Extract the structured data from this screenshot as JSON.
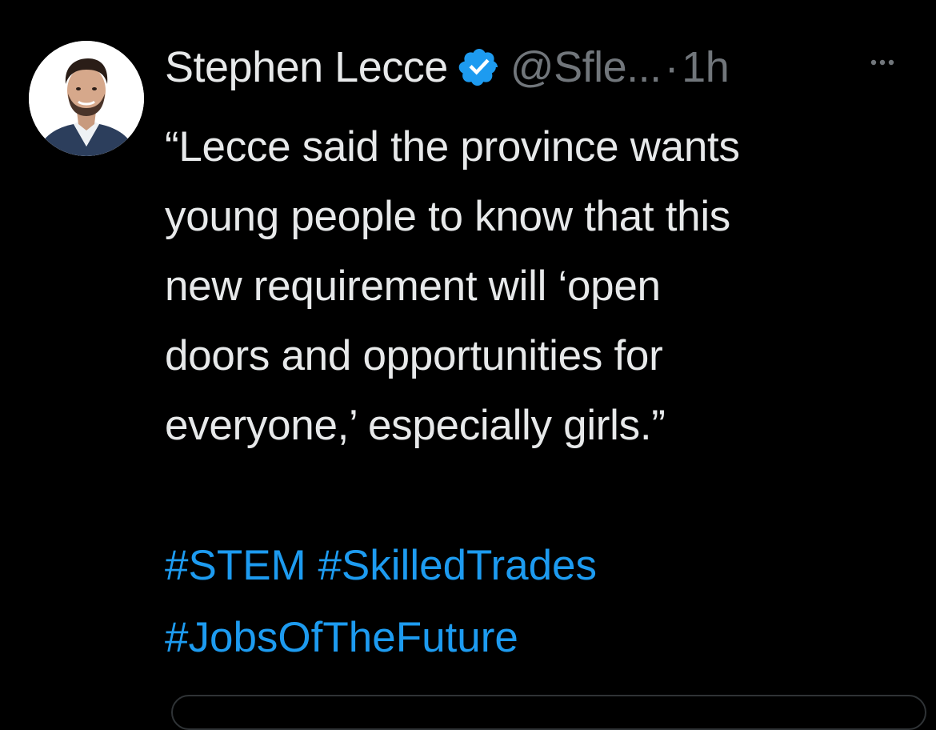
{
  "author": {
    "display_name": "Stephen Lecce",
    "handle": "@Sfle...",
    "separator": "·",
    "time": "1h",
    "verified_icon": "verified-badge-icon",
    "more_icon": "more-options-icon"
  },
  "tweet": {
    "lines": [
      "“Lecce said the province wants",
      "young people to know that this",
      "new requirement will ‘open",
      "doors and opportunities for",
      "everyone,’ especially girls.”"
    ],
    "hashtags": [
      "#STEM",
      "#SkilledTrades",
      "#JobsOfTheFuture"
    ]
  },
  "colors": {
    "background": "#000000",
    "primary_text": "#e7e9ea",
    "secondary_text": "#71767b",
    "link": "#1d9bf0",
    "verified": "#1d9bf0"
  }
}
